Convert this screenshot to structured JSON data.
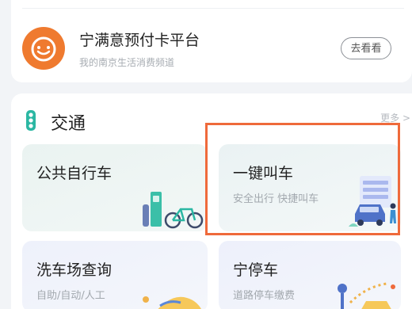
{
  "card": {
    "title": "宁满意预付卡平台",
    "subtitle": "我的南京生活消费频道",
    "button": "去看看"
  },
  "section": {
    "title": "交通",
    "more": "更多 >"
  },
  "tiles": [
    {
      "title": "公共自行车",
      "subtitle": ""
    },
    {
      "title": "一键叫车",
      "subtitle": "安全出行 快捷叫车"
    },
    {
      "title": "洗车场查询",
      "subtitle": "自助/自动/人工"
    },
    {
      "title": "宁停车",
      "subtitle": "道路停车缴费"
    }
  ],
  "colors": {
    "accent": "#ef7a2f",
    "highlight": "#ef6a3b",
    "teal": "#2bb7a3"
  }
}
